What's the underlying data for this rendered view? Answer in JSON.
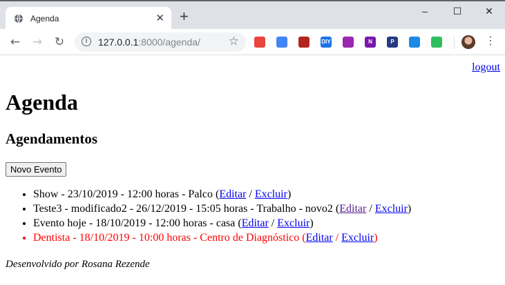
{
  "browser": {
    "tab_title": "Agenda",
    "tab_close": "✕",
    "new_tab": "+",
    "url_host": "127.0.0.1",
    "url_rest": ":8000/agenda/",
    "win_min": "–",
    "win_max": "☐",
    "win_close": "✕",
    "back": "←",
    "forward": "→",
    "reload": "↻",
    "star": "☆",
    "menu": "⋮",
    "extensions": [
      {
        "icon": "megaphone-icon",
        "color": "#e8453c"
      },
      {
        "icon": "translate-icon",
        "color": "#4285f4"
      },
      {
        "icon": "pdf-icon",
        "color": "#b3261e"
      },
      {
        "icon": "diy-icon",
        "color": "#1a73e8",
        "text": "DIY"
      },
      {
        "icon": "feather-icon",
        "color": "#9c27b0"
      },
      {
        "icon": "onenote-icon",
        "color": "#7719aa",
        "text": "N"
      },
      {
        "icon": "paypal-icon",
        "color": "#253b80",
        "text": "P"
      },
      {
        "icon": "window-icon",
        "color": "#1e88e5"
      },
      {
        "icon": "evernote-icon",
        "color": "#2dbe60"
      }
    ]
  },
  "page": {
    "logout": "logout",
    "title": "Agenda",
    "subtitle": "Agendamentos",
    "new_event_button": "Novo Evento",
    "edit_label": "Editar",
    "delete_label": "Excluir",
    "events": [
      {
        "text": "Show - 23/10/2019 - 12:00 horas - Palco (",
        "late": false
      },
      {
        "text": "Teste3 - modificado2 - 26/12/2019 - 15:05 horas - Trabalho - novo2 (",
        "late": false
      },
      {
        "text": "Evento hoje - 18/10/2019 - 12:00 horas - casa (",
        "late": false
      },
      {
        "text": "Dentista - 18/10/2019 - 10:00 horas - Centro de Diagnóstico (",
        "late": true
      }
    ],
    "separator": " / ",
    "close_paren": ")",
    "footer": "Desenvolvido por Rosana Rezende"
  }
}
